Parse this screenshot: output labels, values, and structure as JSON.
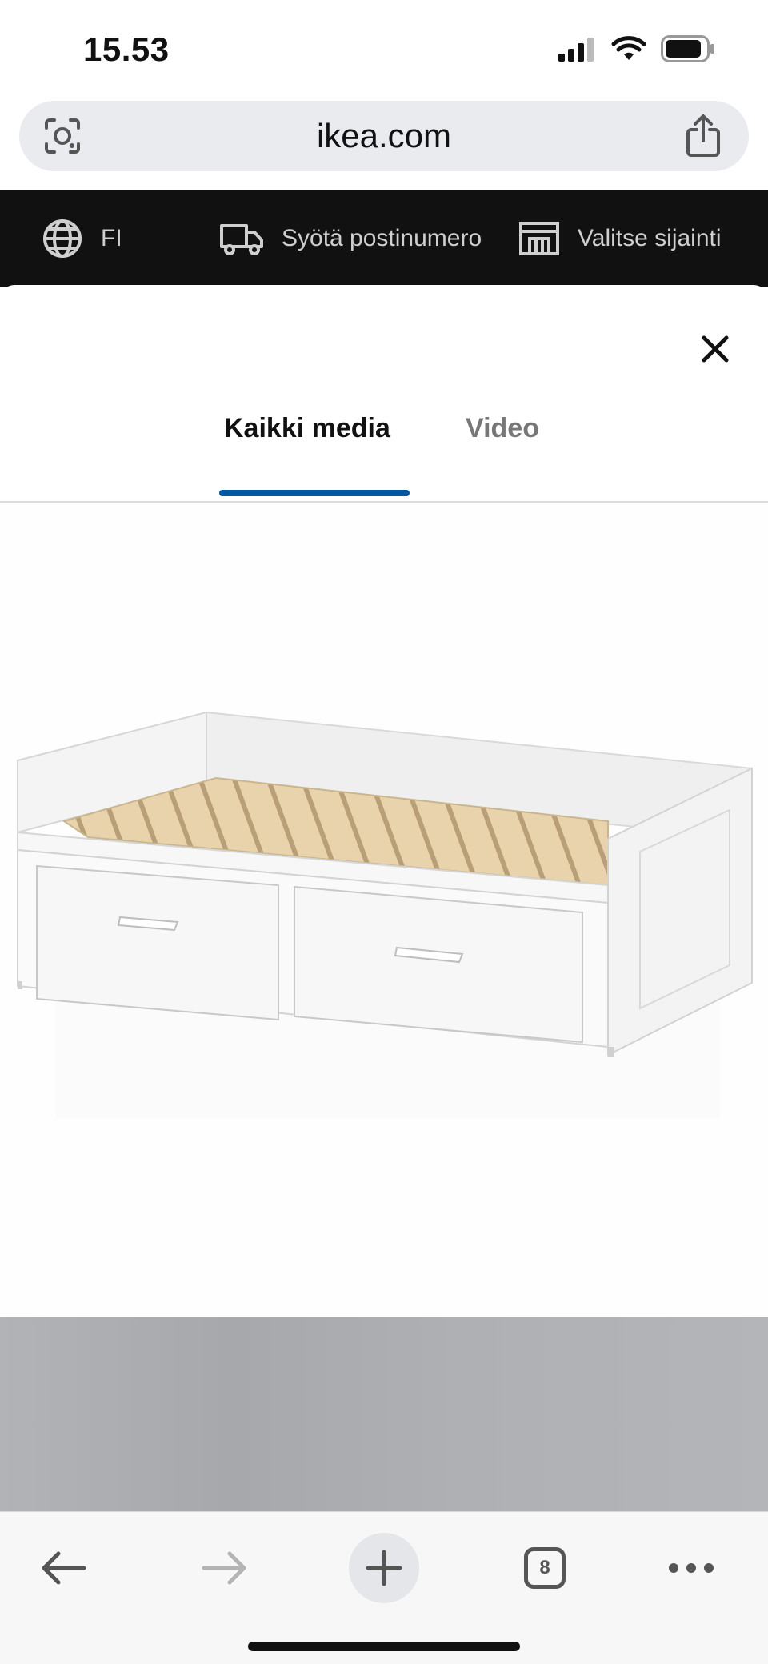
{
  "status_bar": {
    "time": "15.53"
  },
  "browser": {
    "url": "ikea.com",
    "tab_count": "8",
    "icons": [
      "lens-icon",
      "share-icon",
      "back-arrow-icon",
      "forward-arrow-icon",
      "new-tab-plus-icon",
      "tabs-icon",
      "more-icon"
    ]
  },
  "ikea_bar": {
    "language": "FI",
    "postal_code": "Syötä postinumero",
    "store": "Valitse sijainti"
  },
  "media_modal": {
    "tabs": [
      {
        "label": "Kaikki media",
        "active": true
      },
      {
        "label": "Video",
        "active": false
      }
    ],
    "accent_color": "#0058a3"
  }
}
